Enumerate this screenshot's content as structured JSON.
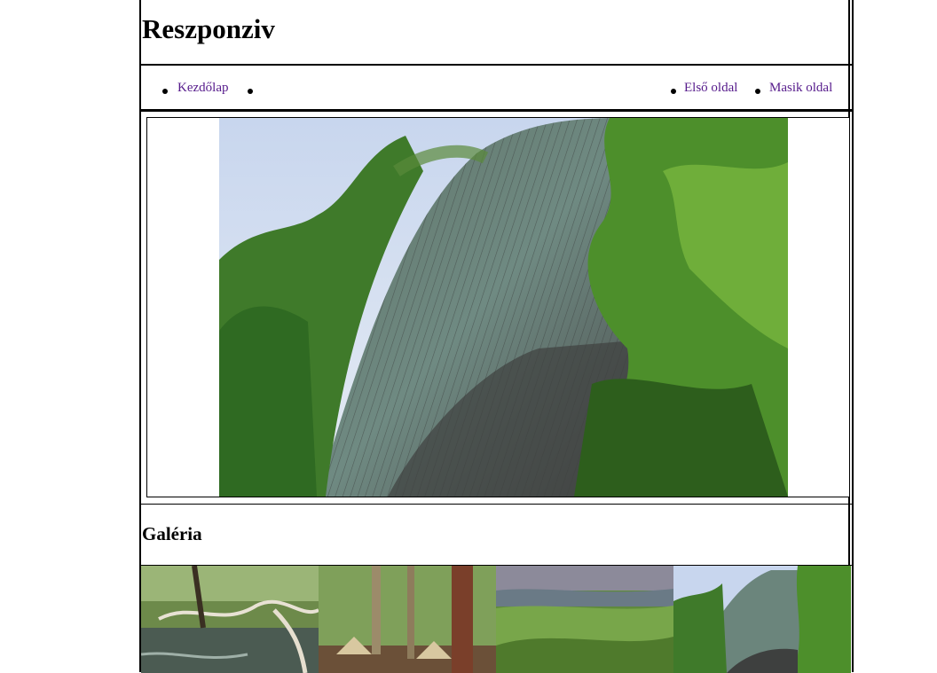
{
  "header": {
    "title": "Reszponziv"
  },
  "nav": {
    "home": "Kezdőlap",
    "first_page": "Első oldal",
    "second_page": "Masik oldal"
  },
  "gallery": {
    "title": "Galéria"
  },
  "colors": {
    "link": "#551a8b",
    "border": "#000000"
  }
}
